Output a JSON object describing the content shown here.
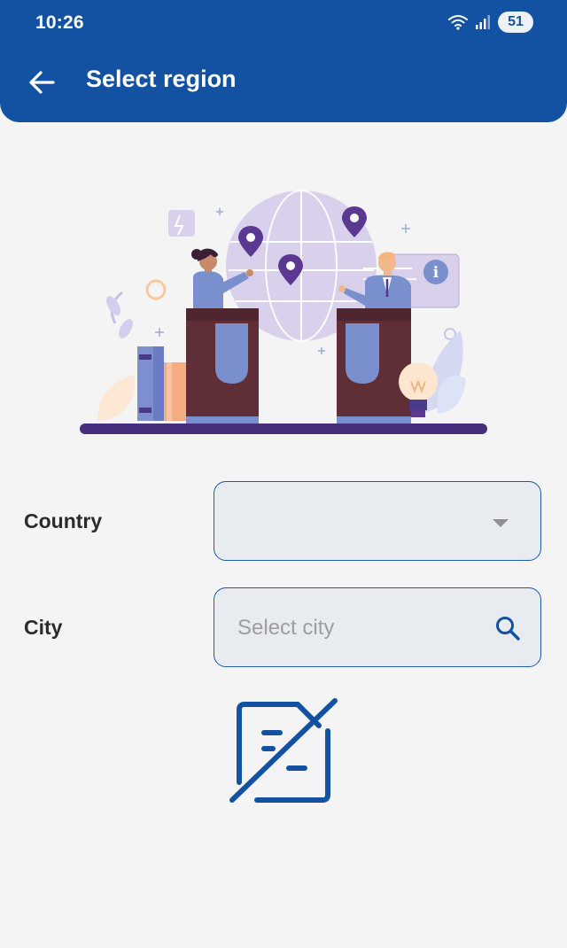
{
  "status_bar": {
    "time": "10:26",
    "battery": "51",
    "icons": [
      "wifi-icon",
      "signal-icon",
      "battery-icon"
    ]
  },
  "app_bar": {
    "title": "Select region",
    "back_icon": "arrow-left-icon"
  },
  "form": {
    "country_label": "Country",
    "country_value": "",
    "city_label": "City",
    "city_placeholder": "Select city"
  },
  "icons": {
    "country_dropdown": "chevron-down-icon",
    "city_search": "search-icon",
    "empty_state": "no-documents-icon"
  },
  "colors": {
    "primary": "#1352a2",
    "background": "#f4f4f4",
    "field_fill": "#e8ebf0",
    "field_border": "#1e5aa8"
  }
}
